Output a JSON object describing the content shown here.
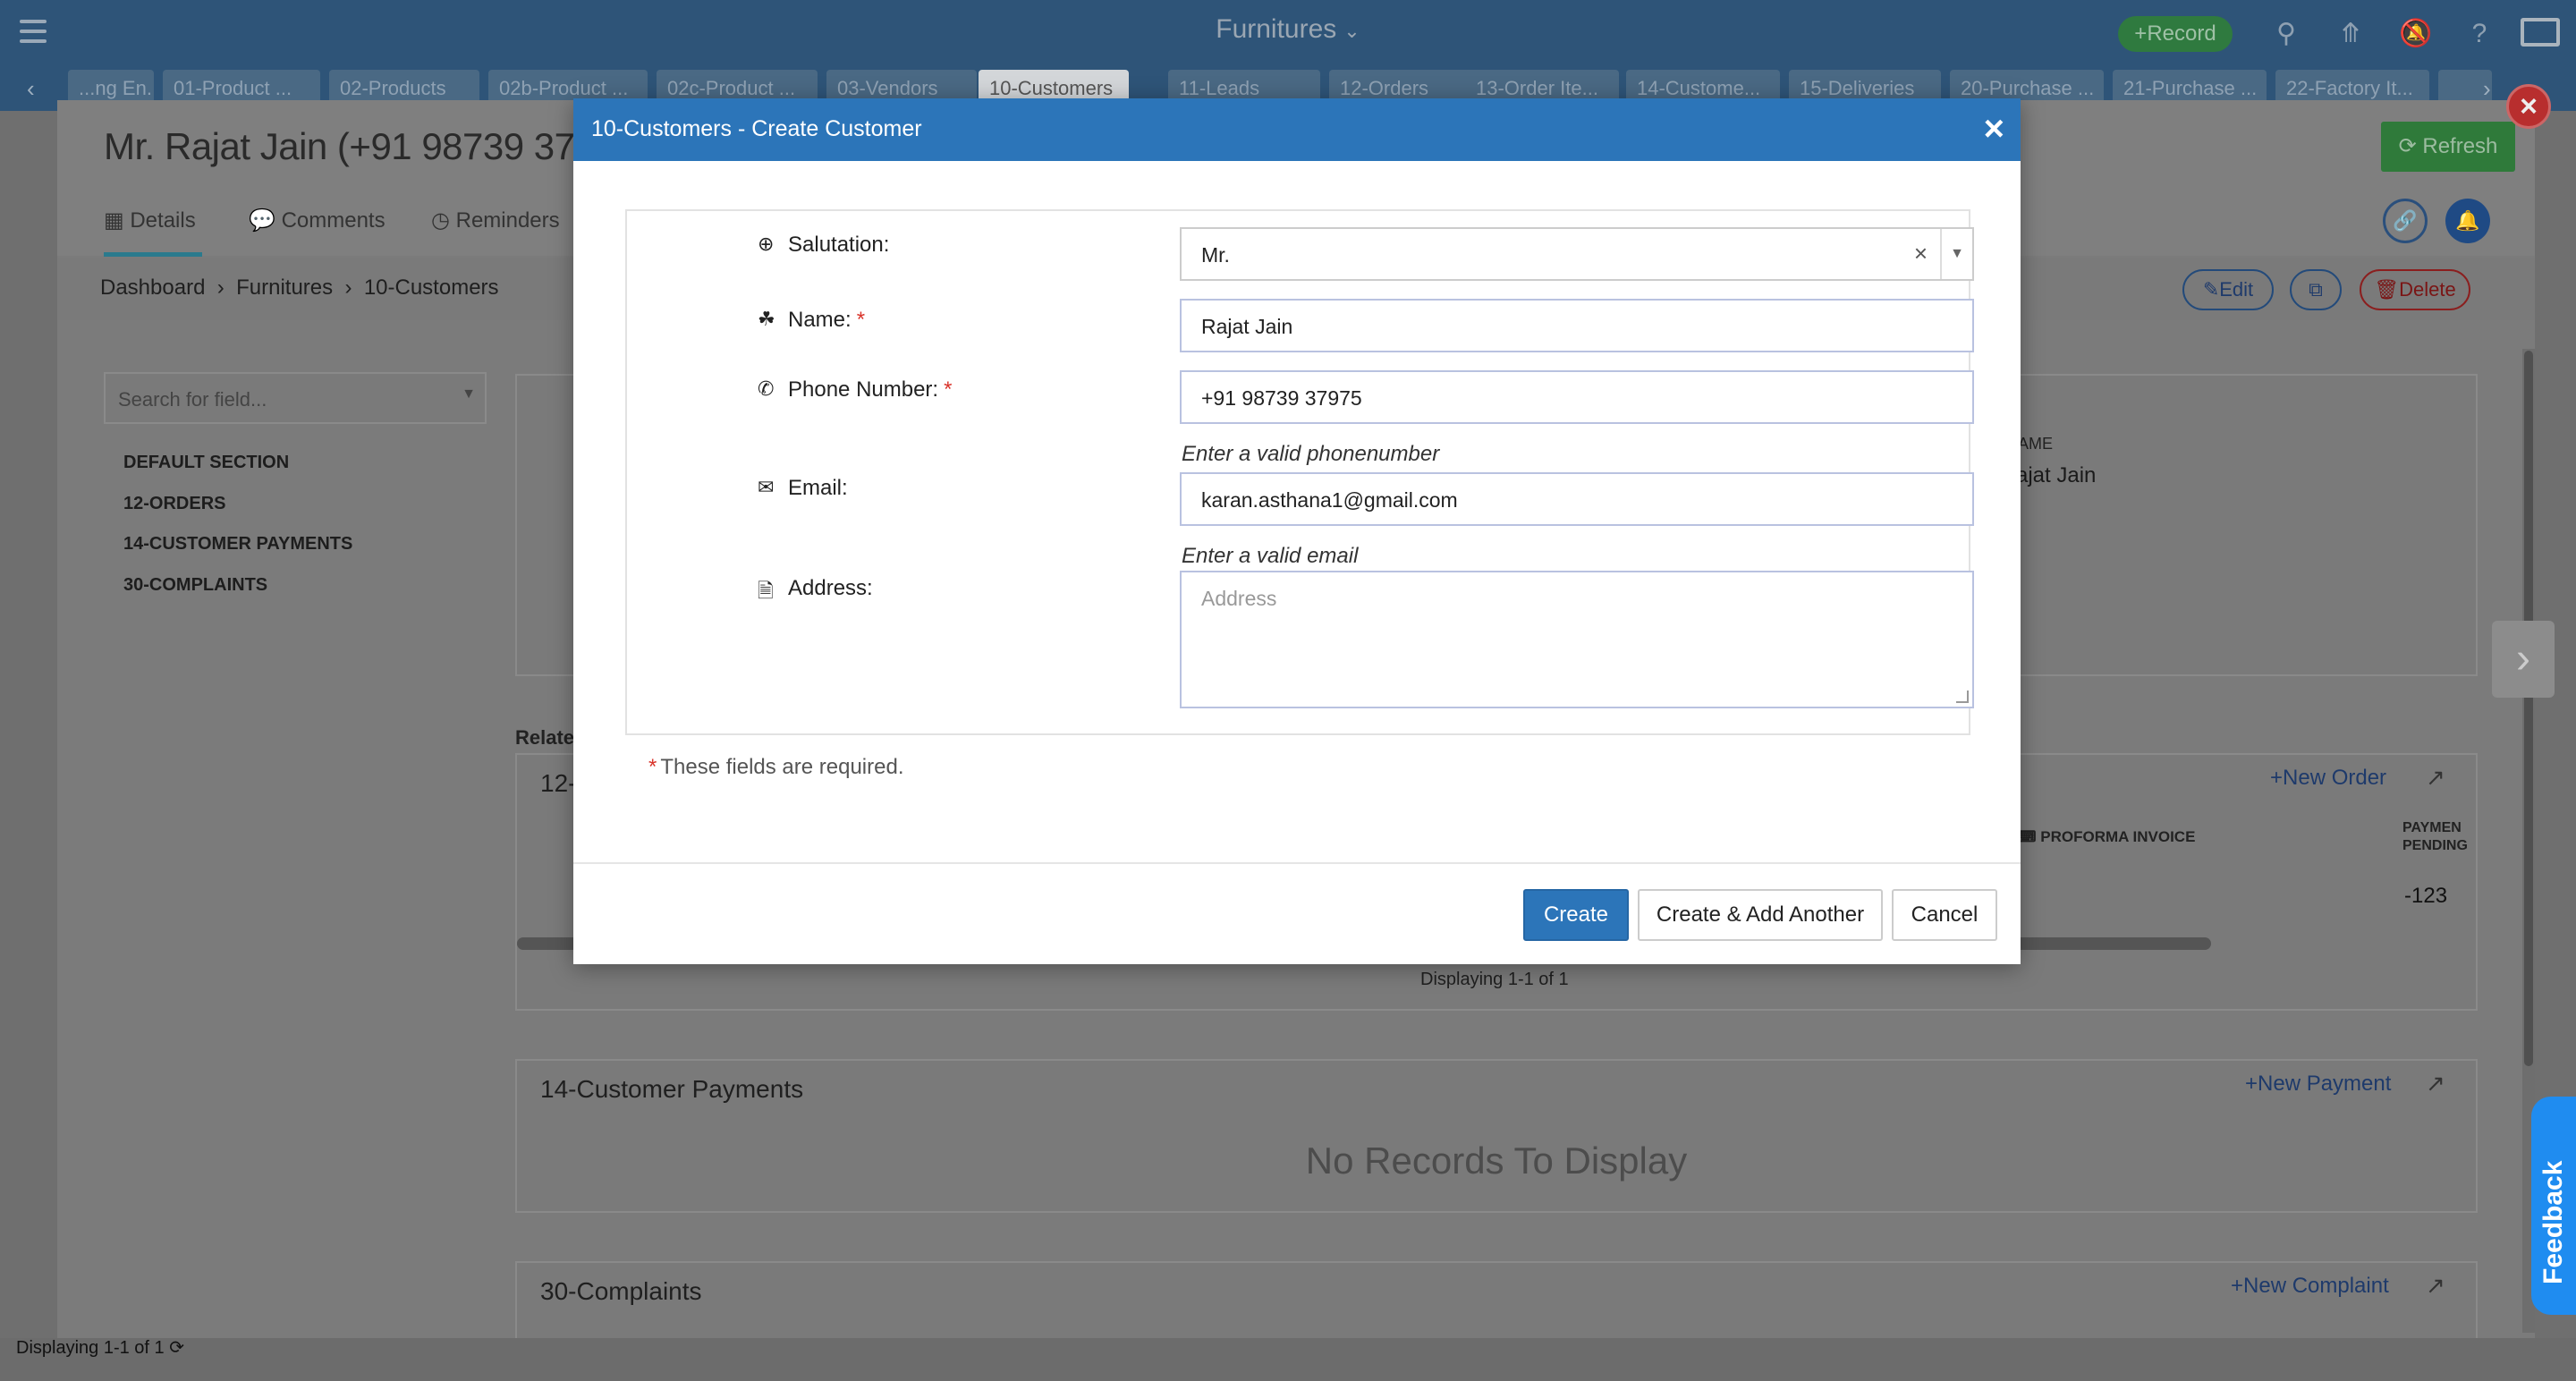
{
  "topbar": {
    "app_title": "Furnitures",
    "record_label": "Record",
    "icons": [
      "menu-icon",
      "search-icon",
      "upload-icon",
      "notifications-off-icon",
      "help-icon",
      "monitor-icon"
    ]
  },
  "tabs": [
    "...ng En...",
    "01-Product ...",
    "02-Products",
    "02b-Product ...",
    "02c-Product ...",
    "03-Vendors",
    "10-Customers",
    "11-Leads",
    "12-Orders",
    "13-Order Ite...",
    "14-Custome...",
    "15-Deliveries",
    "20-Purchase ...",
    "21-Purchase ...",
    "22-Factory It..."
  ],
  "active_tab": "10-Customers",
  "record": {
    "title": "Mr. Rajat Jain (+91 98739 37975",
    "sub_tabs": [
      "Details",
      "Comments",
      "Reminders"
    ],
    "refresh_label": "Refresh",
    "breadcrumb": [
      "Dashboard",
      "Furnitures",
      "10-Customers"
    ],
    "edit_label": "Edit",
    "delete_label": "Delete",
    "search_placeholder": "Search for field...",
    "sections": [
      "DEFAULT SECTION",
      "12-ORDERS",
      "14-CUSTOMER PAYMENTS",
      "30-COMPLAINTS"
    ],
    "name_partial_label": "AME",
    "name_partial_value": "ajat Jain",
    "related_label": "Related",
    "orders_panel_title": "12-",
    "new_order_label": "New Order",
    "proforma_label": "PROFORMA INVOICE",
    "payment_pending_label": "PAYMEN PENDING",
    "payment_pending_value": "-123",
    "orders_displaying": "Displaying 1-1 of 1",
    "payments_title": "14-Customer Payments",
    "new_payment_label": "New Payment",
    "no_records": "No Records To Display",
    "complaints_title": "30-Complaints",
    "new_complaint_label": "New Complaint"
  },
  "footer": {
    "displaying": "Displaying 1-1 of 1"
  },
  "feedback_label": "Feedback",
  "modal": {
    "title": "10-Customers - Create Customer",
    "fields": {
      "salutation": {
        "label": "Salutation:",
        "value": "Mr."
      },
      "name": {
        "label": "Name:",
        "value": "Rajat Jain",
        "required": true
      },
      "phone": {
        "label": "Phone Number:",
        "value": "+91 98739 37975",
        "required": true,
        "hint": "Enter a valid phonenumber"
      },
      "email": {
        "label": "Email:",
        "value": "karan.asthana1@gmail.com",
        "hint": "Enter a valid email"
      },
      "address": {
        "label": "Address:",
        "placeholder": "Address"
      }
    },
    "required_note": "These fields are required.",
    "buttons": {
      "create": "Create",
      "create_another": "Create & Add Another",
      "cancel": "Cancel"
    }
  },
  "colors": {
    "topbar": "#2e5478",
    "modal_header": "#2c75b9",
    "primary_button": "#2c75b9",
    "required": "#d9342b",
    "feedback": "#1f8cf0"
  }
}
